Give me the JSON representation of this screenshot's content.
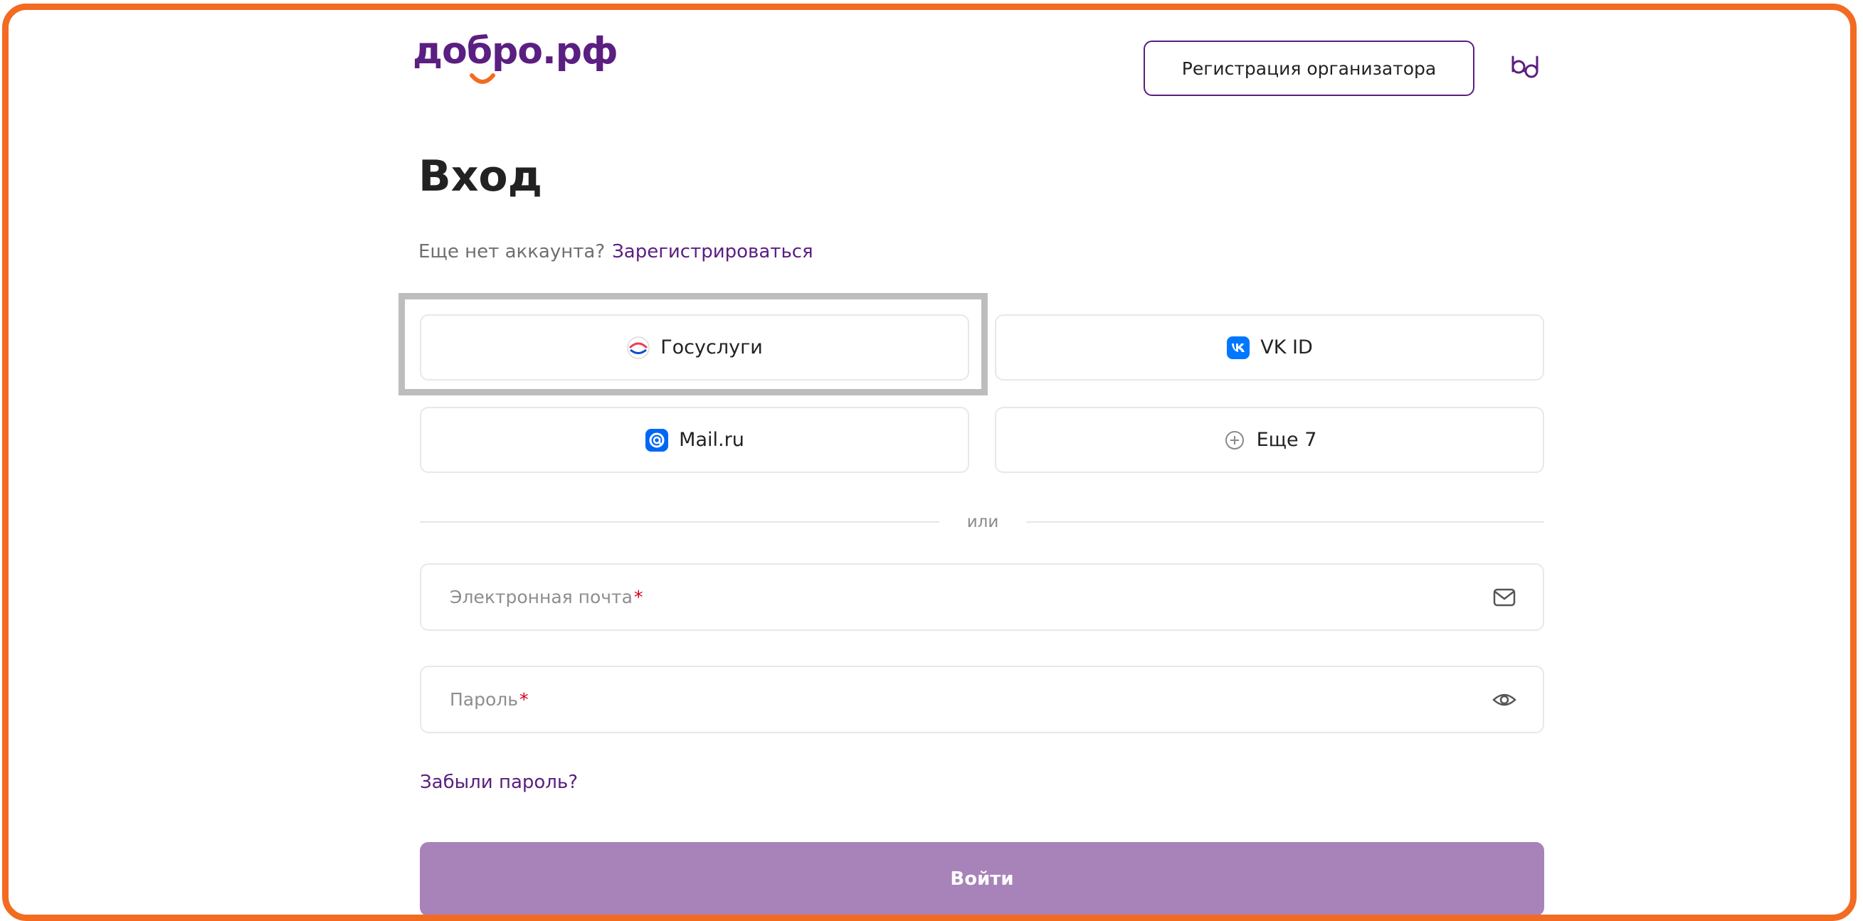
{
  "header": {
    "logo_text": "добро.рф",
    "organizer_button_label": "Регистрация организатора",
    "accessibility_icon": "glasses-icon"
  },
  "main": {
    "title": "Вход",
    "signup_prompt": "Еще нет аккаунта?",
    "signup_link": "Зарегистрироваться",
    "social_logins": [
      {
        "label": "Госуслуги",
        "icon": "gosuslugi-icon"
      },
      {
        "label": "VK ID",
        "icon": "vk-icon"
      },
      {
        "label": "Mail.ru",
        "icon": "mailru-icon"
      },
      {
        "label": "Еще 7",
        "icon": "plus-circle-icon"
      }
    ],
    "divider_text": "или",
    "email_field": {
      "placeholder": "Электронная почта",
      "required_mark": "*",
      "icon": "envelope-icon"
    },
    "password_field": {
      "placeholder": "Пароль",
      "required_mark": "*",
      "icon": "eye-icon"
    },
    "forgot_password": "Забыли пароль?",
    "submit_label": "Войти"
  },
  "colors": {
    "brand": "#5B1E81",
    "accent_orange": "#F26B21",
    "submit_bg": "#A783BA",
    "required": "#D0021B"
  }
}
